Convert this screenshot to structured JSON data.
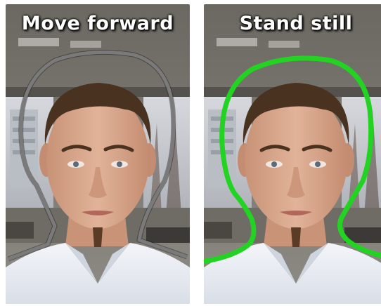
{
  "panels": [
    {
      "caption": "Move forward",
      "outline_state": "too-small",
      "outline_color": "#7a7a7a"
    },
    {
      "caption": "Stand still",
      "outline_state": "aligned",
      "outline_color": "#22d322"
    }
  ],
  "colors": {
    "wall": "#8d8a84",
    "window": "#c9ccd2",
    "hair": "#4a3220",
    "skin": "#d8a78a",
    "shirt": "#e9ecf2"
  }
}
